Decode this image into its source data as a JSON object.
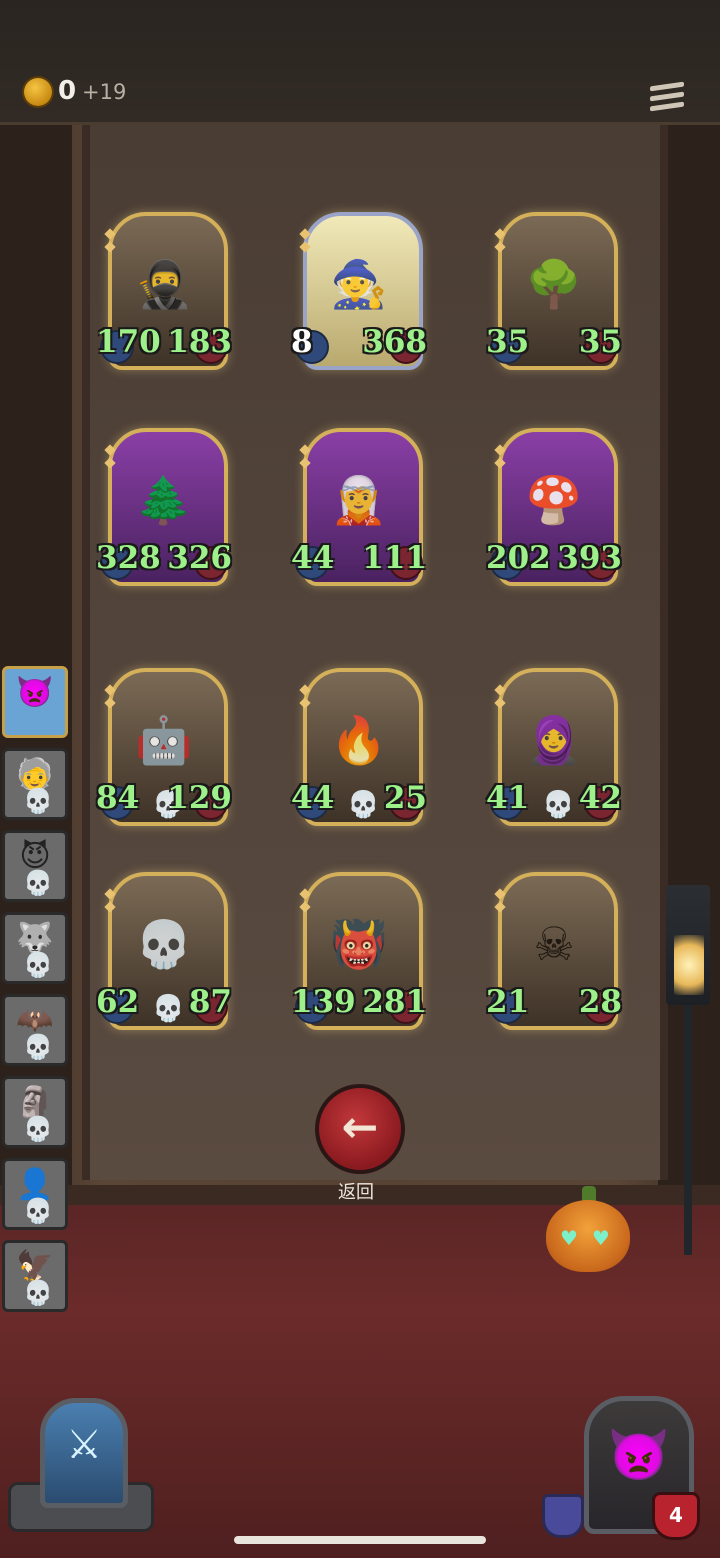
{
  "header": {
    "coin_icon": "crown-coin-icon",
    "coins": "0",
    "coin_bonus": "+19",
    "menu_icon": "hamburger-menu-icon"
  },
  "cards": [
    {
      "name": "hooded-rogue-card",
      "icon": "hooded-assassin-icon",
      "glyph": "🥷",
      "atk": "170",
      "hp": "183",
      "dead": false,
      "frame": "gold"
    },
    {
      "name": "old-dwarf-warrior-card",
      "icon": "bearded-warrior-icon",
      "glyph": "🧙",
      "atk": "8",
      "hp": "368",
      "dead": false,
      "frame": "silver"
    },
    {
      "name": "treant-card",
      "icon": "angry-tree-icon",
      "glyph": "🌳",
      "atk": "35",
      "hp": "35",
      "dead": false,
      "frame": "gold"
    },
    {
      "name": "swamp-tree-card",
      "icon": "spooky-tree-icon",
      "glyph": "🌲",
      "atk": "328",
      "hp": "326",
      "dead": false,
      "frame": "purple"
    },
    {
      "name": "mushroom-elf-card",
      "icon": "elf-girl-icon",
      "glyph": "🧝",
      "atk": "44",
      "hp": "111",
      "dead": false,
      "frame": "purple"
    },
    {
      "name": "spider-mushroom-card",
      "icon": "mushroom-spider-icon",
      "glyph": "🍄",
      "atk": "202",
      "hp": "393",
      "dead": false,
      "frame": "purple"
    },
    {
      "name": "steam-golem-card",
      "icon": "furnace-robot-icon",
      "glyph": "🤖",
      "atk": "84",
      "hp": "129",
      "dead": true,
      "frame": "gold"
    },
    {
      "name": "fire-imp-card",
      "icon": "fire-demon-icon",
      "glyph": "🔥",
      "atk": "44",
      "hp": "25",
      "dead": true,
      "frame": "gold"
    },
    {
      "name": "bandaged-scout-card",
      "icon": "bandaged-head-icon",
      "glyph": "🧕",
      "atk": "41",
      "hp": "42",
      "dead": true,
      "frame": "gold"
    },
    {
      "name": "bone-dragon-card",
      "icon": "dragon-skull-icon",
      "glyph": "💀",
      "atk": "62",
      "hp": "87",
      "dead": true,
      "frame": "gold"
    },
    {
      "name": "red-brute-card",
      "icon": "armored-brute-icon",
      "glyph": "👹",
      "atk": "139",
      "hp": "281",
      "dead": false,
      "frame": "gold"
    },
    {
      "name": "skeleton-shaman-card",
      "icon": "horned-skull-icon",
      "glyph": "☠",
      "atk": "21",
      "hp": "28",
      "dead": false,
      "frame": "gold"
    }
  ],
  "sidebar": [
    {
      "name": "sidebar-blue-imp",
      "icon": "blue-imp-icon",
      "glyph": "👿",
      "active": true,
      "dead": false
    },
    {
      "name": "sidebar-old-wizard",
      "icon": "old-wizard-icon",
      "glyph": "🧓",
      "active": false,
      "dead": true
    },
    {
      "name": "sidebar-dark-figure",
      "icon": "horned-figure-icon",
      "glyph": "😈",
      "active": false,
      "dead": true
    },
    {
      "name": "sidebar-white-beast",
      "icon": "white-beast-icon",
      "glyph": "🐺",
      "active": false,
      "dead": true
    },
    {
      "name": "sidebar-dark-creature",
      "icon": "dark-creature-icon",
      "glyph": "🦇",
      "active": false,
      "dead": true
    },
    {
      "name": "sidebar-rock-golem",
      "icon": "rock-golem-icon",
      "glyph": "🗿",
      "active": false,
      "dead": true
    },
    {
      "name": "sidebar-hooded-woman",
      "icon": "hooded-woman-icon",
      "glyph": "👤",
      "active": false,
      "dead": true
    },
    {
      "name": "sidebar-gargoyle",
      "icon": "gargoyle-icon",
      "glyph": "🦅",
      "active": false,
      "dead": true
    }
  ],
  "back": {
    "icon": "back-arrow-icon",
    "arrow": "←",
    "label": "返回"
  },
  "pet": {
    "icon": "pumpkin-pet-icon"
  },
  "bottom": {
    "deck_icon": "portal-deck-icon",
    "deck_glyph": "⚔",
    "hero_icon": "blue-imp-hero-icon",
    "hero_glyph": "👿",
    "shield_icon": "shield-icon",
    "hero_hp": "4"
  }
}
